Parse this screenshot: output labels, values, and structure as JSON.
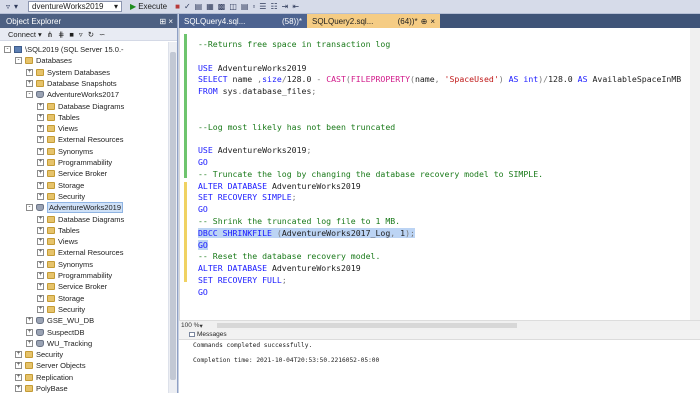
{
  "toolbar": {
    "database": "dventureWorks2019",
    "execute_label": "Execute"
  },
  "object_explorer": {
    "title": "Object Explorer",
    "connect_label": "Connect",
    "nodes": [
      {
        "label": "\\SQL2019 (SQL Server 15.0.-",
        "level": 0,
        "expand": "-",
        "icon": "server"
      },
      {
        "label": "Databases",
        "level": 1,
        "expand": "-",
        "icon": "folder"
      },
      {
        "label": "System Databases",
        "level": 2,
        "expand": "+",
        "icon": "folder"
      },
      {
        "label": "Database Snapshots",
        "level": 2,
        "expand": "+",
        "icon": "folder"
      },
      {
        "label": "AdventureWorks2017",
        "level": 2,
        "expand": "-",
        "icon": "db"
      },
      {
        "label": "Database Diagrams",
        "level": 3,
        "expand": "+",
        "icon": "folder"
      },
      {
        "label": "Tables",
        "level": 3,
        "expand": "+",
        "icon": "folder"
      },
      {
        "label": "Views",
        "level": 3,
        "expand": "+",
        "icon": "folder"
      },
      {
        "label": "External Resources",
        "level": 3,
        "expand": "+",
        "icon": "folder"
      },
      {
        "label": "Synonyms",
        "level": 3,
        "expand": "+",
        "icon": "folder"
      },
      {
        "label": "Programmability",
        "level": 3,
        "expand": "+",
        "icon": "folder"
      },
      {
        "label": "Service Broker",
        "level": 3,
        "expand": "+",
        "icon": "folder"
      },
      {
        "label": "Storage",
        "level": 3,
        "expand": "+",
        "icon": "folder"
      },
      {
        "label": "Security",
        "level": 3,
        "expand": "+",
        "icon": "folder"
      },
      {
        "label": "AdventureWorks2019",
        "level": 2,
        "expand": "-",
        "icon": "db",
        "selected": true
      },
      {
        "label": "Database Diagrams",
        "level": 3,
        "expand": "+",
        "icon": "folder"
      },
      {
        "label": "Tables",
        "level": 3,
        "expand": "+",
        "icon": "folder"
      },
      {
        "label": "Views",
        "level": 3,
        "expand": "+",
        "icon": "folder"
      },
      {
        "label": "External Resources",
        "level": 3,
        "expand": "+",
        "icon": "folder"
      },
      {
        "label": "Synonyms",
        "level": 3,
        "expand": "+",
        "icon": "folder"
      },
      {
        "label": "Programmability",
        "level": 3,
        "expand": "+",
        "icon": "folder"
      },
      {
        "label": "Service Broker",
        "level": 3,
        "expand": "+",
        "icon": "folder"
      },
      {
        "label": "Storage",
        "level": 3,
        "expand": "+",
        "icon": "folder"
      },
      {
        "label": "Security",
        "level": 3,
        "expand": "+",
        "icon": "folder"
      },
      {
        "label": "GSE_WU_DB",
        "level": 2,
        "expand": "+",
        "icon": "db"
      },
      {
        "label": "SuspectDB",
        "level": 2,
        "expand": "+",
        "icon": "db"
      },
      {
        "label": "WU_Tracking",
        "level": 2,
        "expand": "+",
        "icon": "db"
      },
      {
        "label": "Security",
        "level": 1,
        "expand": "+",
        "icon": "folder"
      },
      {
        "label": "Server Objects",
        "level": 1,
        "expand": "+",
        "icon": "folder"
      },
      {
        "label": "Replication",
        "level": 1,
        "expand": "+",
        "icon": "folder"
      },
      {
        "label": "PolyBase",
        "level": 1,
        "expand": "+",
        "icon": "folder"
      }
    ]
  },
  "tabs": [
    {
      "name": "SQLQuery4.sql...",
      "suffix": "(58))*",
      "active": false
    },
    {
      "name": "SQLQuery2.sql...",
      "suffix": "(64))*",
      "active": true
    }
  ],
  "editor": {
    "lines": [
      [
        {
          "t": "--Returns free space in transaction log",
          "c": "cm"
        }
      ],
      [],
      [
        {
          "t": "USE ",
          "c": "kw"
        },
        {
          "t": "AdventureWorks2019",
          "c": "tx"
        }
      ],
      [
        {
          "t": "SELECT ",
          "c": "kw"
        },
        {
          "t": "name ",
          "c": "tx"
        },
        {
          "t": ",",
          "c": "gy"
        },
        {
          "t": "size",
          "c": "kw"
        },
        {
          "t": "/",
          "c": "gy"
        },
        {
          "t": "128.0 ",
          "c": "tx"
        },
        {
          "t": "- ",
          "c": "gy"
        },
        {
          "t": "CAST",
          "c": "fn"
        },
        {
          "t": "(",
          "c": "gy"
        },
        {
          "t": "FILEPROPERTY",
          "c": "fn"
        },
        {
          "t": "(",
          "c": "gy"
        },
        {
          "t": "name",
          "c": "tx"
        },
        {
          "t": ", ",
          "c": "gy"
        },
        {
          "t": "'SpaceUsed'",
          "c": "st"
        },
        {
          "t": ") ",
          "c": "gy"
        },
        {
          "t": "AS ",
          "c": "kw"
        },
        {
          "t": "int",
          "c": "kw"
        },
        {
          "t": ")",
          "c": "gy"
        },
        {
          "t": "/",
          "c": "gy"
        },
        {
          "t": "128.0 ",
          "c": "tx"
        },
        {
          "t": "AS ",
          "c": "kw"
        },
        {
          "t": "AvailableSpaceInMB",
          "c": "tx"
        }
      ],
      [
        {
          "t": "FROM ",
          "c": "kw"
        },
        {
          "t": "sys",
          "c": "tx"
        },
        {
          "t": ".",
          "c": "gy"
        },
        {
          "t": "database_files",
          "c": "tx"
        },
        {
          "t": ";",
          "c": "gy"
        }
      ],
      [],
      [],
      [
        {
          "t": "--Log most likely has not been truncated",
          "c": "cm"
        }
      ],
      [],
      [
        {
          "t": "USE ",
          "c": "kw"
        },
        {
          "t": "AdventureWorks2019",
          "c": "tx"
        },
        {
          "t": ";",
          "c": "gy"
        }
      ],
      [
        {
          "t": "GO",
          "c": "kw"
        }
      ],
      [
        {
          "t": "-- Truncate the log by changing the database recovery model to SIMPLE.",
          "c": "cm"
        }
      ],
      [
        {
          "t": "ALTER DATABASE ",
          "c": "kw"
        },
        {
          "t": "AdventureWorks2019",
          "c": "tx"
        }
      ],
      [
        {
          "t": "SET RECOVERY SIMPLE",
          "c": "kw"
        },
        {
          "t": ";",
          "c": "gy"
        }
      ],
      [
        {
          "t": "GO",
          "c": "kw"
        }
      ],
      [
        {
          "t": "-- Shrink the truncated log file to 1 MB.",
          "c": "cm"
        }
      ],
      [
        {
          "t": "DBCC SHRINKFILE ",
          "c": "kw",
          "hl": true
        },
        {
          "t": "(",
          "c": "gy",
          "hl": true
        },
        {
          "t": "AdventureWorks2017_Log",
          "c": "tx",
          "hl": true
        },
        {
          "t": ", ",
          "c": "gy",
          "hl": true
        },
        {
          "t": "1",
          "c": "tx",
          "hl": true
        },
        {
          "t": ");",
          "c": "gy",
          "hl": true
        }
      ],
      [
        {
          "t": "GO",
          "c": "kw",
          "hl": true
        }
      ],
      [
        {
          "t": "-- Reset the database recovery model.",
          "c": "cm"
        }
      ],
      [
        {
          "t": "ALTER DATABASE ",
          "c": "kw"
        },
        {
          "t": "AdventureWorks2019",
          "c": "tx"
        }
      ],
      [
        {
          "t": "SET RECOVERY FULL",
          "c": "kw"
        },
        {
          "t": ";",
          "c": "gy"
        }
      ],
      [
        {
          "t": "GO",
          "c": "kw"
        }
      ]
    ]
  },
  "status": {
    "zoom": "100 %"
  },
  "messages": {
    "tab_label": "Messages",
    "line1": "Commands completed successfully.",
    "line2": "Completion time: 2021-10-04T20:53:50.2216052-05:00"
  }
}
